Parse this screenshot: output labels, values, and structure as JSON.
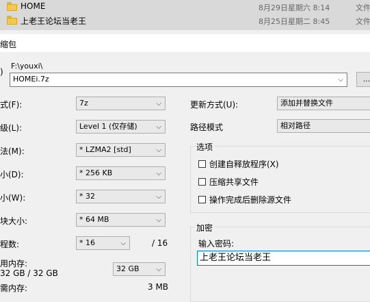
{
  "explorer": {
    "files": [
      {
        "name": "HOME",
        "date": "8月29日星期六 8:14",
        "type": "文件"
      },
      {
        "name": "上老王论坛当老王",
        "date": "8月25日星期二 8:45",
        "type": "文件"
      }
    ]
  },
  "dialog": {
    "title": "缩包",
    "archive_label": ")",
    "path": "F:\\youxi\\",
    "archive_value": "HOMEi.7z",
    "browse_label": "..."
  },
  "left_fields": {
    "format": {
      "label": "式(F):",
      "value": "7z"
    },
    "level": {
      "label": "级(L):",
      "value": "Level 1 (仅存储)"
    },
    "method": {
      "label": "法(M):",
      "value": "* LZMA2 [std]"
    },
    "dict": {
      "label": "小(D):",
      "value": "* 256 KB"
    },
    "word": {
      "label": "小(W):",
      "value": "* 32"
    },
    "block": {
      "label": "块大小:",
      "value": "* 64 MB"
    },
    "threads": {
      "label": "程数:",
      "value": "* 16",
      "max": "/ 16"
    },
    "memory": {
      "label": "用内存:",
      "sub": "32 GB / 32 GB",
      "value": "32 GB"
    },
    "decompress": {
      "label": "需内存:",
      "value": "3 MB"
    }
  },
  "right_fields": {
    "update": {
      "label": "更新方式(U):",
      "value": "添加并替换文件"
    },
    "path": {
      "label": "路径模式",
      "value": "相对路径"
    }
  },
  "options": {
    "title": "选项",
    "items": [
      {
        "label": "创建自释放程序(X)"
      },
      {
        "label": "压缩共享文件"
      },
      {
        "label": "操作完成后删除源文件"
      }
    ]
  },
  "encryption": {
    "title": "加密",
    "password_label": "输入密码:",
    "password_value": "上老王论坛当老王"
  }
}
